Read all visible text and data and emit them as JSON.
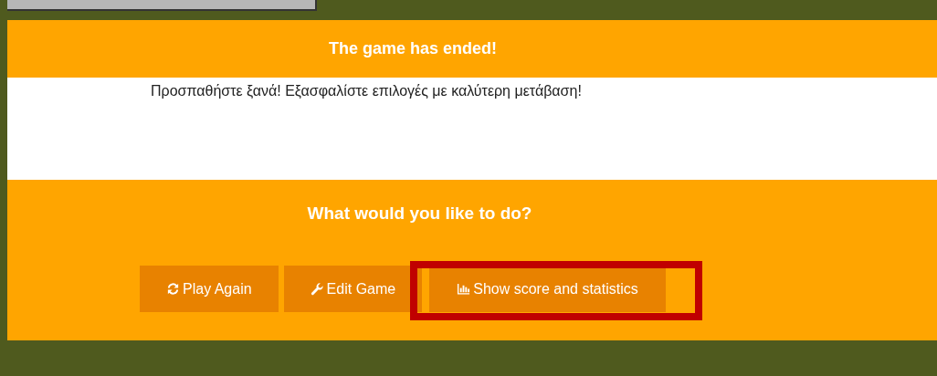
{
  "header": {
    "title": "The game has ended!"
  },
  "message": "Προσπαθήστε ξανά! Εξασφαλίστε επιλογές με καλύτερη μετάβαση!",
  "prompt": "What would you like to do?",
  "buttons": [
    {
      "label": "Play Again",
      "highlighted": false
    },
    {
      "label": "Edit Game",
      "highlighted": false
    },
    {
      "label": "Show score and statistics",
      "highlighted": true
    }
  ]
}
